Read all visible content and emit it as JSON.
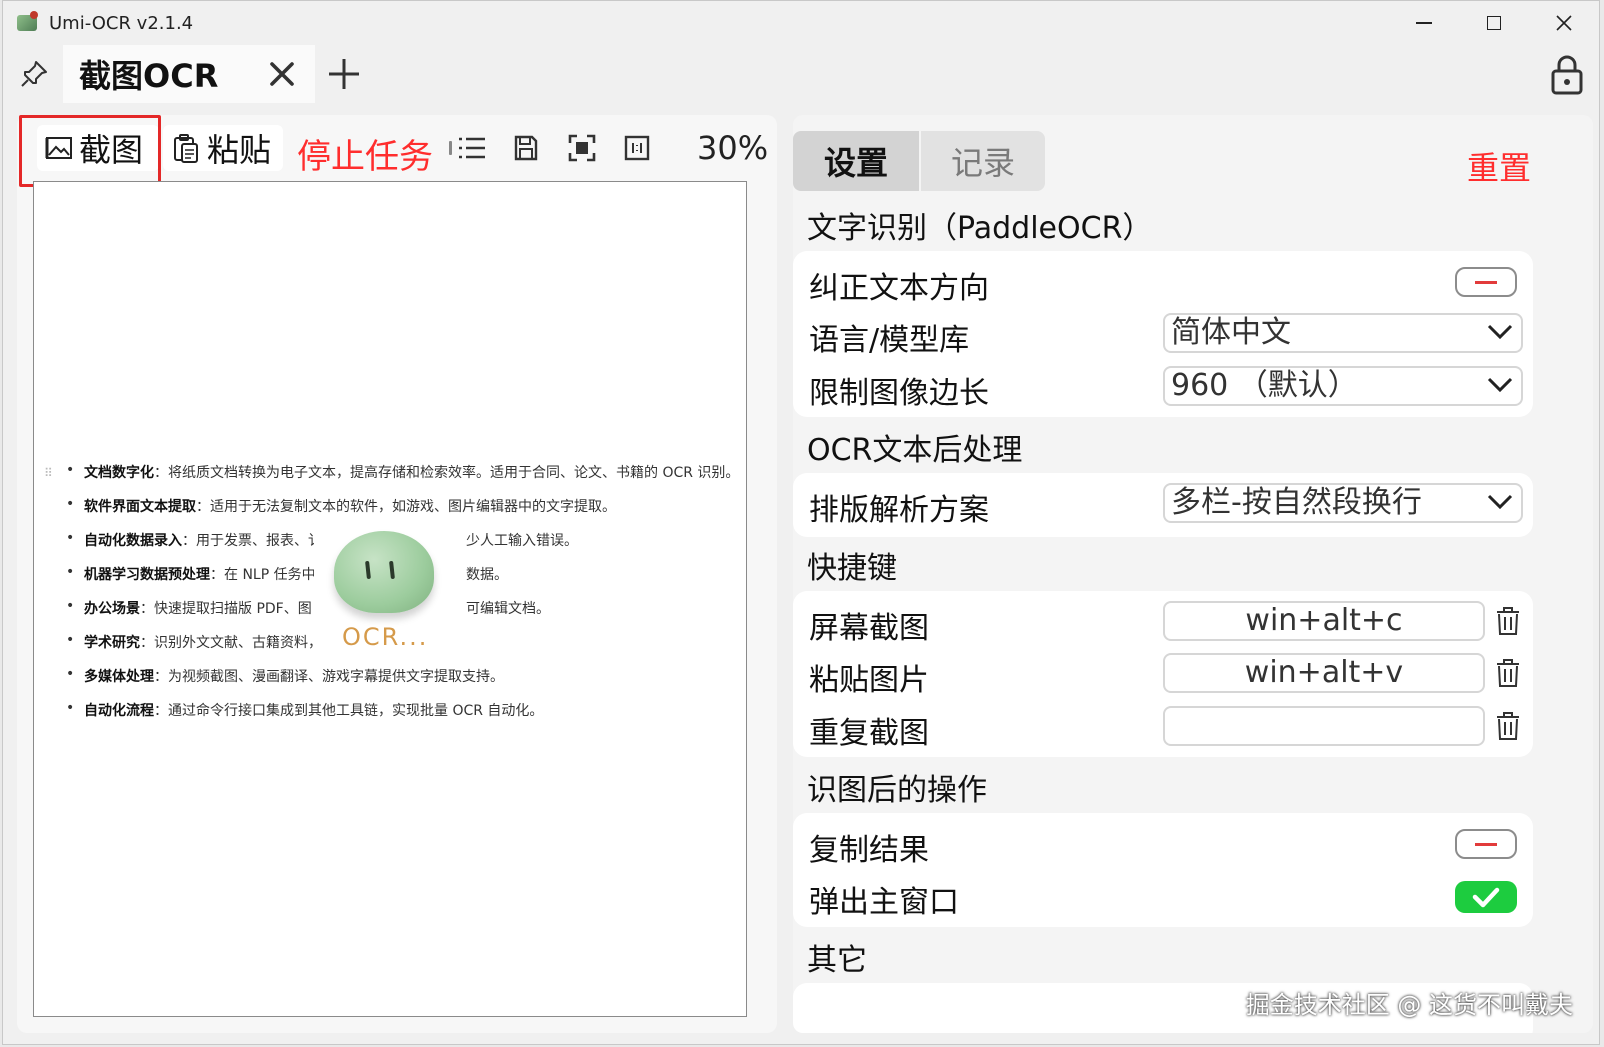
{
  "window": {
    "title": "Umi-OCR v2.1.4"
  },
  "tabs": {
    "active_label": "截图OCR"
  },
  "toolbar": {
    "capture_label": "截图",
    "paste_label": "粘贴",
    "stop_label": "停止任务",
    "zoom": "30%"
  },
  "preview": {
    "items": [
      {
        "bold": "文档数字化",
        "text": "：将纸质文档转换为电子文本，提高存储和检索效率。适用于合同、论文、书籍的 OCR 识别。"
      },
      {
        "bold": "软件界面文本提取",
        "text": "：适用于无法复制文本的软件，如游戏、图片编辑器中的文字提取。"
      },
      {
        "bold": "自动化数据录入",
        "text": "：用于发票、报表、讠",
        "tail": "少人工输入错误。"
      },
      {
        "bold": "机器学习数据预处理",
        "text": "：在 NLP 任务中",
        "tail": "数据。"
      },
      {
        "bold": "办公场景",
        "text": "：快速提取扫描版 PDF、图",
        "tail": "可编辑文档。"
      },
      {
        "bold": "学术研究",
        "text": "：识别外文文献、古籍资料，"
      },
      {
        "bold": "多媒体处理",
        "text": "：为视频截图、漫画翻译、游戏字幕提供文字提取支持。"
      },
      {
        "bold": "自动化流程",
        "text": "：通过命令行接口集成到其他工具链，实现批量 OCR 自动化。"
      }
    ],
    "loading_text": "OCR..."
  },
  "settings": {
    "tab_settings": "设置",
    "tab_records": "记录",
    "reset": "重置",
    "ocr_section": "文字识别（PaddleOCR）",
    "correct_direction": "纠正文本方向",
    "correct_direction_on": false,
    "language_label": "语言/模型库",
    "language_value": "简体中文",
    "limit_label": "限制图像边长",
    "limit_value": "960 （默认）",
    "post_section": "OCR文本后处理",
    "layout_label": "排版解析方案",
    "layout_value": "多栏-按自然段换行",
    "hotkey_section": "快捷键",
    "hk_capture_label": "屏幕截图",
    "hk_capture_value": "win+alt+c",
    "hk_paste_label": "粘贴图片",
    "hk_paste_value": "win+alt+v",
    "hk_repeat_label": "重复截图",
    "hk_repeat_value": "",
    "after_section": "识图后的操作",
    "copy_result_label": "复制结果",
    "copy_result_on": false,
    "popup_label": "弹出主窗口",
    "popup_on": true,
    "other_section": "其它"
  },
  "watermark": "掘金技术社区 @ 这货不叫戴夫",
  "colors": {
    "accent_red": "#ff2d2d",
    "toggle_on": "#1dcc3f"
  }
}
